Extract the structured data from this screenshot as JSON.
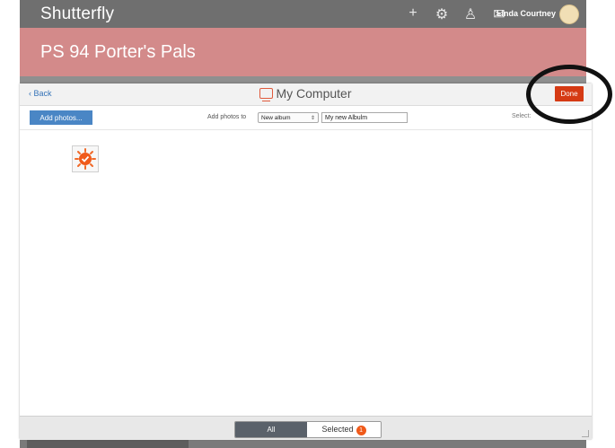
{
  "app": {
    "brand": "Shutterfly",
    "user_name": "Linda Courtney",
    "top_icons": [
      "plus-icon",
      "gear-icon",
      "person-icon",
      "mail-icon"
    ],
    "group_title": "PS 94 Porter's Pals"
  },
  "modal": {
    "back_label": "Back",
    "title": "My Computer",
    "done_label": "Done",
    "add_photos_label": "Add photos...",
    "add_to_label": "Add photos to",
    "album_select_value": "New album",
    "album_name_value": "My new Albulm",
    "select_label": "Select:",
    "footer": {
      "tab_all": "All",
      "tab_selected": "Selected",
      "selected_count": "1"
    }
  },
  "colors": {
    "accent_red": "#d53a14",
    "group_header": "#d38a8a",
    "button_blue": "#4a86c5",
    "badge_orange": "#f05a1a"
  }
}
